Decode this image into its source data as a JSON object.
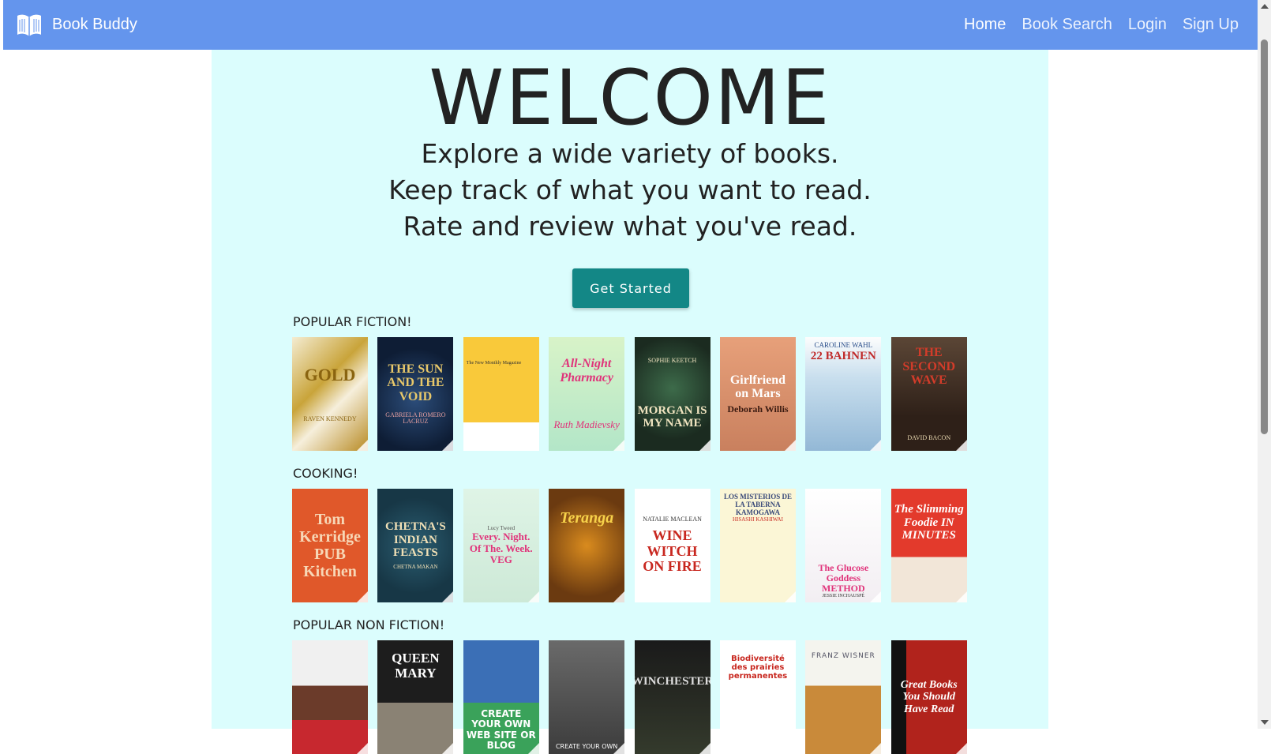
{
  "nav": {
    "brand": "Book Buddy",
    "links": [
      "Home",
      "Book Search",
      "Login",
      "Sign Up"
    ],
    "active_link": "Home"
  },
  "hero": {
    "title": "WELCOME",
    "lines": [
      "Explore a wide variety of books.",
      "Keep track of what you want to read.",
      "Rate and review what you've read."
    ],
    "cta": "Get Started",
    "cta_color": "#138786"
  },
  "colors": {
    "navbar": "#6495ed",
    "main_bg": "#dbfdfd"
  },
  "sections": [
    {
      "label": "POPULAR FICTION!",
      "books": [
        {
          "title": "GOLD",
          "author": "RAVEN KENNEDY"
        },
        {
          "title": "THE SUN AND THE VOID",
          "author": "GABRIELA ROMERO LACRUZ"
        },
        {
          "title": "The New Monthly Magazine",
          "author": ""
        },
        {
          "title": "All-Night Pharmacy",
          "author": "Ruth Madievsky"
        },
        {
          "title": "MORGAN IS MY NAME",
          "author": "SOPHIE KEETCH"
        },
        {
          "title": "Girlfriend on Mars",
          "author": "Deborah Willis"
        },
        {
          "title": "22 BAHNEN",
          "author": "CAROLINE WAHL"
        },
        {
          "title": "THE SECOND WAVE",
          "author": "DAVID BACON"
        }
      ]
    },
    {
      "label": "COOKING!",
      "books": [
        {
          "title": "Tom Kerridge PUB Kitchen",
          "author": ""
        },
        {
          "title": "CHETNA'S INDIAN FEASTS",
          "author": "CHETNA MAKAN"
        },
        {
          "title": "Every. Night. Of The. Week. VEG",
          "author": "Lucy Tweed"
        },
        {
          "title": "Teranga",
          "author": ""
        },
        {
          "title": "WINE WITCH ON FIRE",
          "author": "NATALIE MACLEAN"
        },
        {
          "title": "LOS MISTERIOS DE LA TABERNA KAMOGAWA",
          "author": "HISASHI KASHIWAI"
        },
        {
          "title": "The Glucose Goddess METHOD",
          "author": "JESSIE INCHAUSPÉ"
        },
        {
          "title": "The Slimming Foodie IN MINUTES",
          "author": ""
        }
      ]
    },
    {
      "label": "POPULAR NON FICTION!",
      "books": [
        {
          "title": "",
          "author": ""
        },
        {
          "title": "QUEEN MARY",
          "author": ""
        },
        {
          "title": "CREATE YOUR OWN WEB SITE OR BLOG",
          "author": ""
        },
        {
          "title": "CREATE YOUR OWN",
          "author": ""
        },
        {
          "title": "WINCHESTER",
          "author": ""
        },
        {
          "title": "Biodiversité des prairies permanentes",
          "author": ""
        },
        {
          "title": "FRANZ WISNER",
          "author": ""
        },
        {
          "title": "Great Books You Should Have Read",
          "author": ""
        }
      ]
    }
  ]
}
